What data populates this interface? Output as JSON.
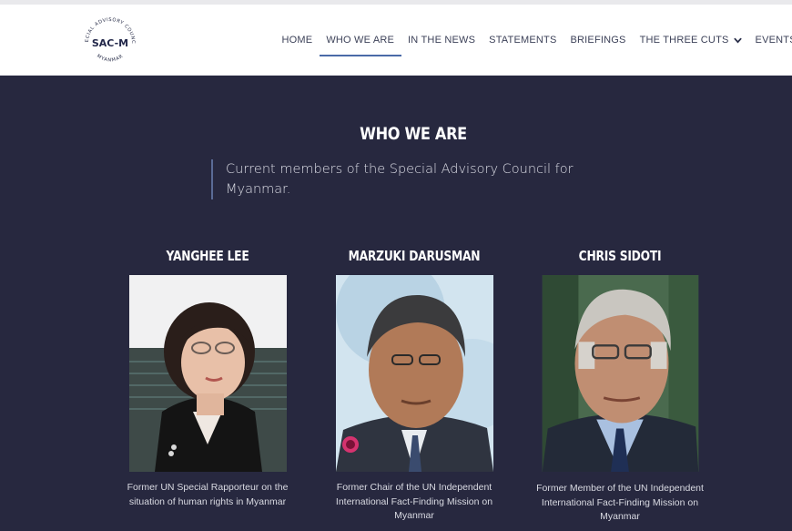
{
  "header": {
    "logo": {
      "text": "SAC-M",
      "ring_top": "SPECIAL ADVISORY COUNCIL",
      "ring_bottom": "MYANMAR"
    },
    "nav": [
      {
        "label": "HOME",
        "active": false
      },
      {
        "label": "WHO WE ARE",
        "active": true
      },
      {
        "label": "IN THE NEWS",
        "active": false
      },
      {
        "label": "STATEMENTS",
        "active": false
      },
      {
        "label": "BRIEFINGS",
        "active": false
      },
      {
        "label": "THE THREE CUTS",
        "active": false,
        "icon": "chevron-down-icon"
      },
      {
        "label": "EVENTS",
        "active": false
      }
    ]
  },
  "main": {
    "title": "WHO WE ARE",
    "intro": "Current members of the Special Advisory Council for Myanmar.",
    "members": [
      {
        "name": "YANGHEE LEE",
        "description": "Former UN Special Rapporteur on the situation of human rights in Myanmar"
      },
      {
        "name": "MARZUKI DARUSMAN",
        "description": "Former Chair of the UN Independent International Fact-Finding Mission on Myanmar"
      },
      {
        "name": "CHRIS SIDOTI",
        "description": "Former Member of the UN Independent International Fact-Finding Mission on Myanmar"
      }
    ]
  },
  "colors": {
    "background": "#27283f",
    "header": "#ffffff",
    "nav_text": "#3c4158",
    "active_underline": "#4a6aa8",
    "quote_bar": "#5a6b96"
  }
}
